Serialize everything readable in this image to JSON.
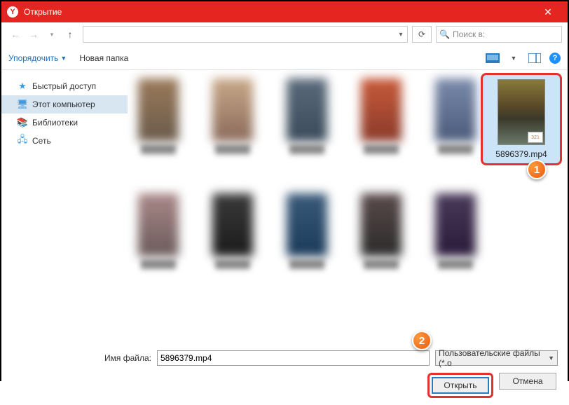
{
  "titlebar": {
    "logo": "Y",
    "title": "Открытие"
  },
  "nav": {
    "search_placeholder": "Поиск в:"
  },
  "toolbar": {
    "organize": "Упорядочить",
    "new_folder": "Новая папка"
  },
  "sidebar": {
    "items": [
      {
        "label": "Быстрый доступ"
      },
      {
        "label": "Этот компьютер"
      },
      {
        "label": "Библиотеки"
      },
      {
        "label": "Сеть"
      }
    ]
  },
  "selected": {
    "name": "5896379.mp4",
    "tag": "321"
  },
  "markers": {
    "one": "1",
    "two": "2"
  },
  "footer": {
    "filename_label": "Имя файла:",
    "filename_value": "5896379.mp4",
    "filter": "Пользовательские файлы (*.o",
    "open": "Открыть",
    "cancel": "Отмена"
  }
}
